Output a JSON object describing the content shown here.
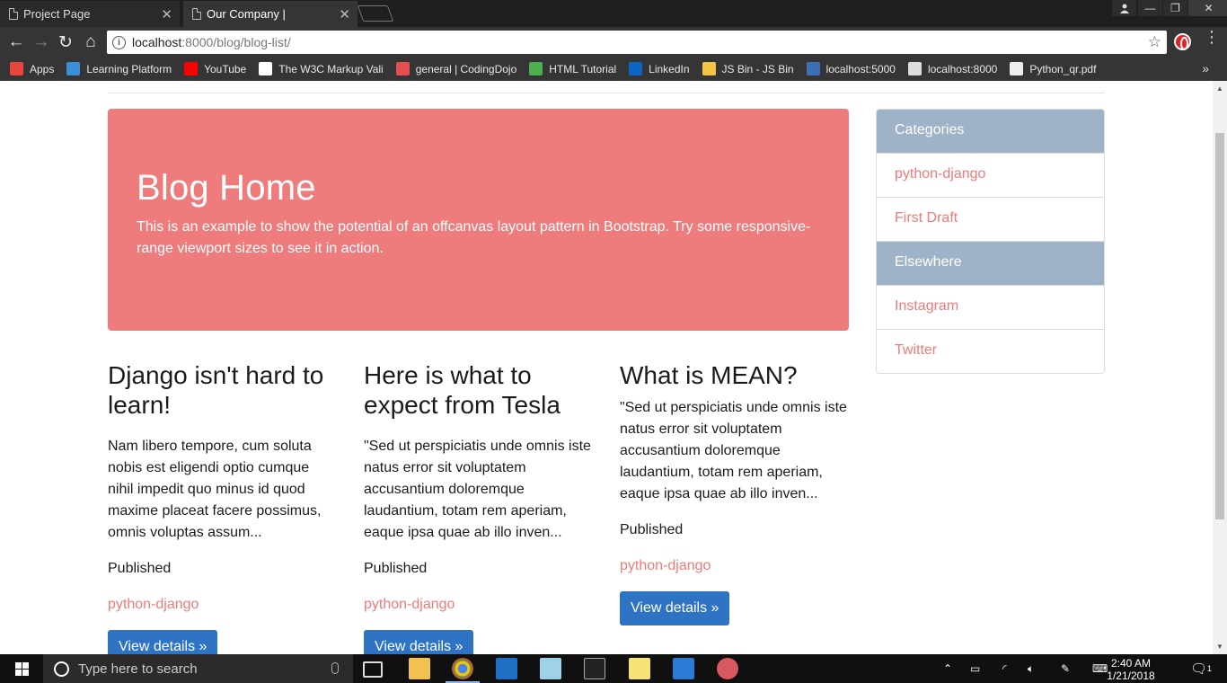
{
  "browser": {
    "tabs": [
      {
        "title": "Project Page",
        "active": false
      },
      {
        "title": "Our Company |",
        "active": true
      }
    ],
    "url_host": "localhost",
    "url_rest": ":8000/blog/blog-list/",
    "bookmarks": [
      {
        "label": "Apps",
        "icon": "apps-grid-icon",
        "color": "#e8453c"
      },
      {
        "label": "Learning Platform",
        "icon": "learning-platform-icon",
        "color": "#3b8fd6"
      },
      {
        "label": "YouTube",
        "icon": "youtube-icon",
        "color": "#ff0000"
      },
      {
        "label": "The W3C Markup Vali",
        "icon": "w3c-icon",
        "color": "#ffffff"
      },
      {
        "label": "general | CodingDojo",
        "icon": "codingdojo-icon",
        "color": "#e34f4f"
      },
      {
        "label": "HTML Tutorial",
        "icon": "w3schools-icon",
        "color": "#4caf50"
      },
      {
        "label": "LinkedIn",
        "icon": "linkedin-icon",
        "color": "#0a66c2"
      },
      {
        "label": "JS Bin - JS Bin",
        "icon": "jsbin-icon",
        "color": "#f5c542"
      },
      {
        "label": "localhost:5000",
        "icon": "terminal-icon",
        "color": "#3d6fb5"
      },
      {
        "label": "localhost:8000",
        "icon": "page-icon",
        "color": "#dddddd"
      },
      {
        "label": "Python_qr.pdf",
        "icon": "pdf-icon",
        "color": "#eeeeee"
      }
    ]
  },
  "page": {
    "jumbotron": {
      "title": "Blog Home",
      "text": "This is an example to show the potential of an offcanvas layout pattern in Bootstrap. Try some responsive-range viewport sizes to see it in action."
    },
    "posts": [
      {
        "title": "Django isn't hard to learn!",
        "excerpt": "Nam libero tempore, cum soluta nobis est eligendi optio cumque nihil impedit quo minus id quod maxime placeat facere possimus, omnis voluptas assum...",
        "published": "Published",
        "category": "python-django",
        "button": "View details »"
      },
      {
        "title": "Here is what to expect from Tesla",
        "excerpt": "\"Sed ut perspiciatis unde omnis iste natus error sit voluptatem accusantium doloremque laudantium, totam rem aperiam, eaque ipsa quae ab illo inven...",
        "published": "Published",
        "category": "python-django",
        "button": "View details »"
      },
      {
        "title": "What is MEAN?",
        "excerpt": "\"Sed ut perspiciatis unde omnis iste natus error sit voluptatem accusantium doloremque laudantium, totam rem aperiam, eaque ipsa quae ab illo inven...",
        "published": "Published",
        "category": "python-django",
        "button": "View details »"
      }
    ],
    "sidebar": {
      "categories_heading": "Categories",
      "categories": [
        "python-django",
        "First Draft"
      ],
      "elsewhere_heading": "Elsewhere",
      "elsewhere": [
        "Instagram",
        "Twitter"
      ]
    },
    "colors": {
      "jumbotron": "#ee7c7c",
      "link": "#ec7b7b",
      "sidebar_heading": "#9fb3c8",
      "button": "#2f73c4"
    }
  },
  "taskbar": {
    "search_placeholder": "Type here to search",
    "time": "2:40 AM",
    "date": "1/21/2018",
    "notification_count": "1"
  }
}
